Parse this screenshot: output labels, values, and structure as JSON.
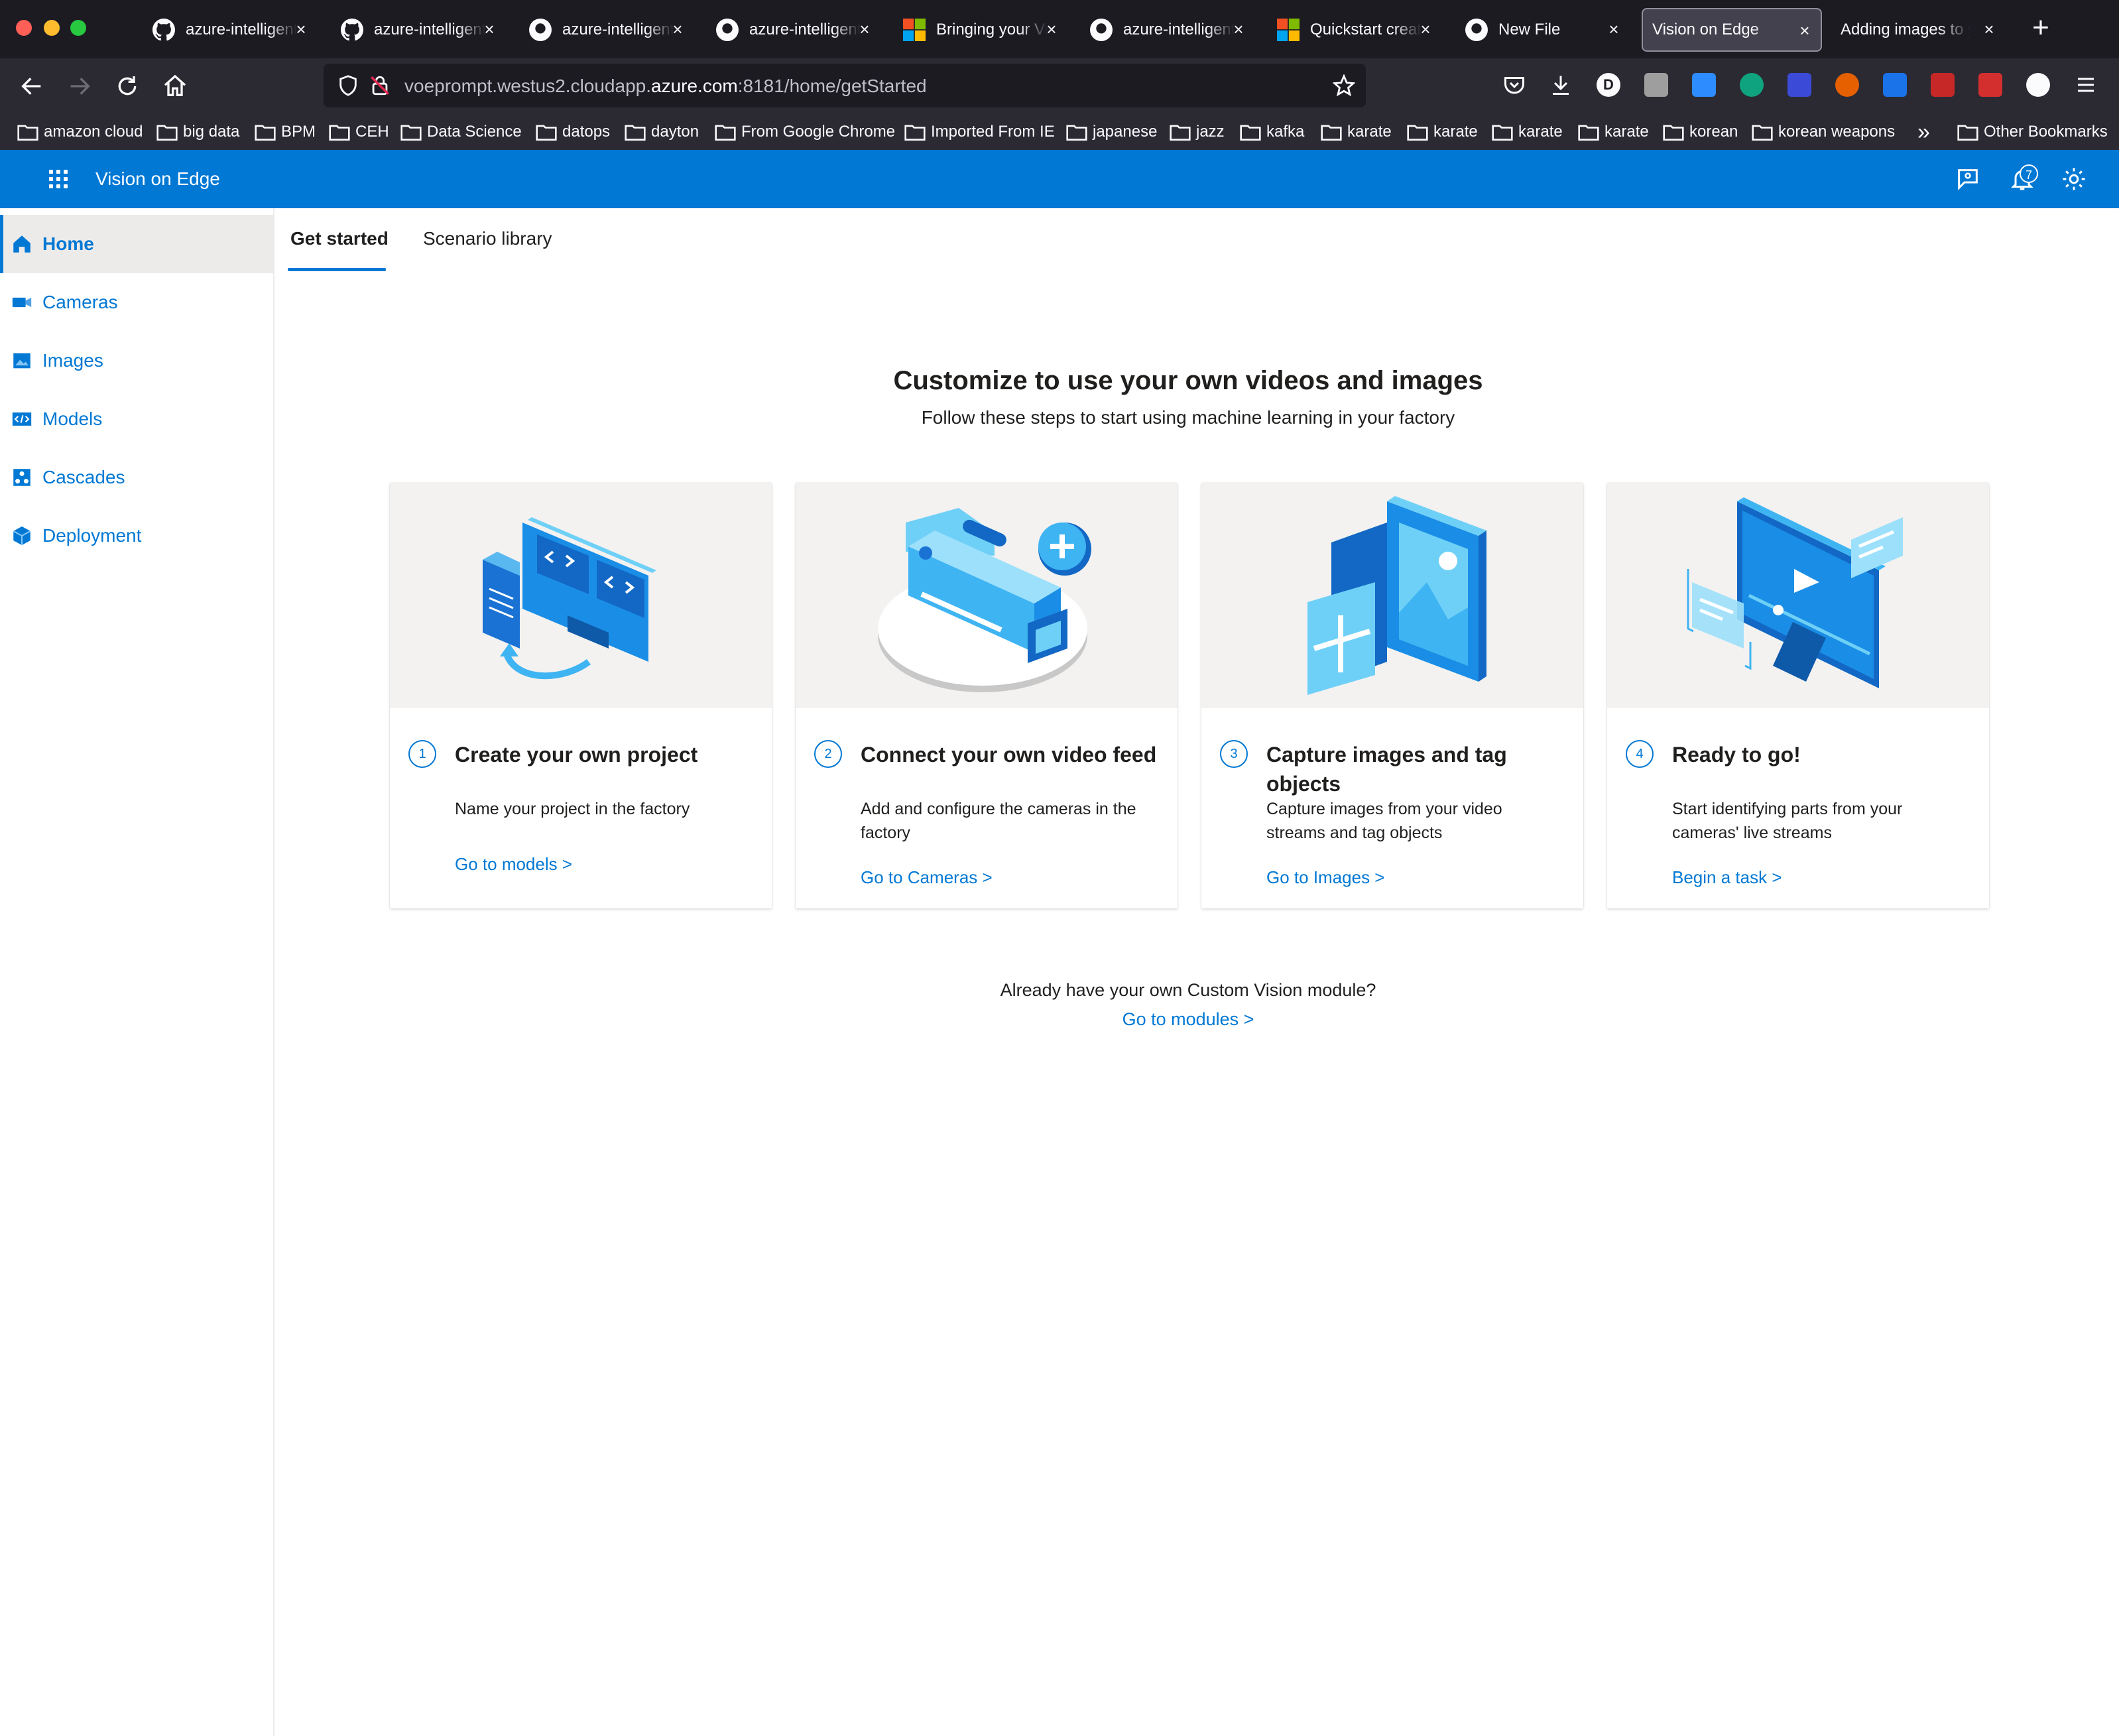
{
  "browser": {
    "tabs": [
      {
        "title": "azure-intelligent-edge-patterns",
        "icon": "github-icon"
      },
      {
        "title": "azure-intelligent-edge-patterns",
        "icon": "github-icon"
      },
      {
        "title": "azure-intelligent-edge-patterns",
        "icon": "github-icon"
      },
      {
        "title": "azure-intelligent-edge-patterns",
        "icon": "github-icon"
      },
      {
        "title": "Bringing your Vision AI",
        "icon": "microsoft-icon"
      },
      {
        "title": "azure-intelligent-edge-patterns",
        "icon": "github-icon"
      },
      {
        "title": "Quickstart create",
        "icon": "microsoft-icon"
      },
      {
        "title": "New File",
        "icon": "github-icon"
      },
      {
        "title": "Vision on Edge",
        "icon": "none"
      },
      {
        "title": "Adding images to your",
        "icon": "none"
      }
    ],
    "url": {
      "prefix": "voeprompt.westus2.cloudapp.",
      "domain": "azure.com",
      "suffix": ":8181/home/getStarted"
    },
    "bookmarks": [
      "amazon cloud",
      "big data",
      "BPM",
      "CEH",
      "Data Science",
      "datops",
      "dayton",
      "From Google Chrome",
      "Imported From IE",
      "japanese",
      "jazz",
      "kafka",
      "karate",
      "karate",
      "karate",
      "karate",
      "korean",
      "korean weapons"
    ],
    "other_bookmarks": "Other Bookmarks",
    "overflow": "»"
  },
  "app": {
    "title": "Vision on Edge",
    "notification_count": "7",
    "accent": "#0078d4"
  },
  "sidebar": {
    "items": [
      {
        "label": "Home",
        "icon": "home-icon",
        "active": true
      },
      {
        "label": "Cameras",
        "icon": "camera-icon"
      },
      {
        "label": "Images",
        "icon": "images-icon"
      },
      {
        "label": "Models",
        "icon": "models-icon"
      },
      {
        "label": "Cascades",
        "icon": "cascades-icon"
      },
      {
        "label": "Deployment",
        "icon": "deployment-icon"
      }
    ]
  },
  "main": {
    "tabs": [
      {
        "label": "Get started",
        "active": true
      },
      {
        "label": "Scenario library"
      }
    ],
    "hero": {
      "title": "Customize to use your own videos and images",
      "subtitle": "Follow these steps to start using machine learning in your factory"
    },
    "cards": [
      {
        "step": "1",
        "title": "Create your own project",
        "description": "Name your project in the factory",
        "link": "Go to models >"
      },
      {
        "step": "2",
        "title": "Connect your own video feed",
        "description": "Add and configure the cameras in the factory",
        "link": "Go to Cameras >"
      },
      {
        "step": "3",
        "title": "Capture images and tag objects",
        "description": "Capture images from your video streams and tag objects",
        "link": "Go to Images >"
      },
      {
        "step": "4",
        "title": "Ready to go!",
        "description": "Start identifying parts from your cameras' live streams",
        "link": "Begin a task >"
      }
    ],
    "footer": {
      "question": "Already have your own Custom Vision module?",
      "link": "Go to modules >"
    }
  }
}
